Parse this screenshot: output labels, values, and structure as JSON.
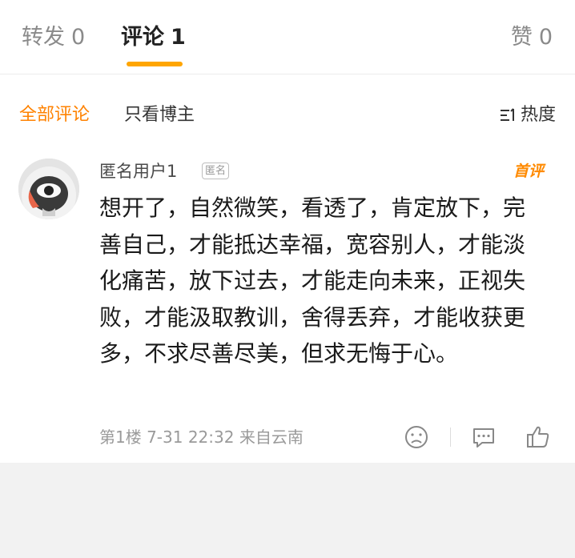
{
  "tabs": [
    {
      "label": "转发",
      "count": "0"
    },
    {
      "label": "评论",
      "count": "1"
    },
    {
      "label": "赞",
      "count": "0"
    }
  ],
  "filters": {
    "all": "全部评论",
    "blogger_only": "只看博主",
    "sort": "热度"
  },
  "comment": {
    "username": "匿名用户1",
    "anon_badge": "匿名",
    "first_badge": "首评",
    "text": "想开了，自然微笑，看透了，肯定放下，完善自己，才能抵达幸福，宽容别人，才能淡化痛苦，放下过去，才能走向未来，正视失败，才能汲取教训，舍得丢弃，才能收获更多，不求尽善尽美，但求无悔于心。",
    "meta": "第1楼 7-31 22:32 来自云南"
  },
  "icons": {
    "sort": "sort-icon",
    "dislike": "sad-face-icon",
    "reply": "comment-bubble-icon",
    "like": "thumbs-up-icon"
  },
  "colors": {
    "accent": "#ff8200",
    "tab_underline": "#ffa500",
    "first_badge": "#ff8a00"
  }
}
